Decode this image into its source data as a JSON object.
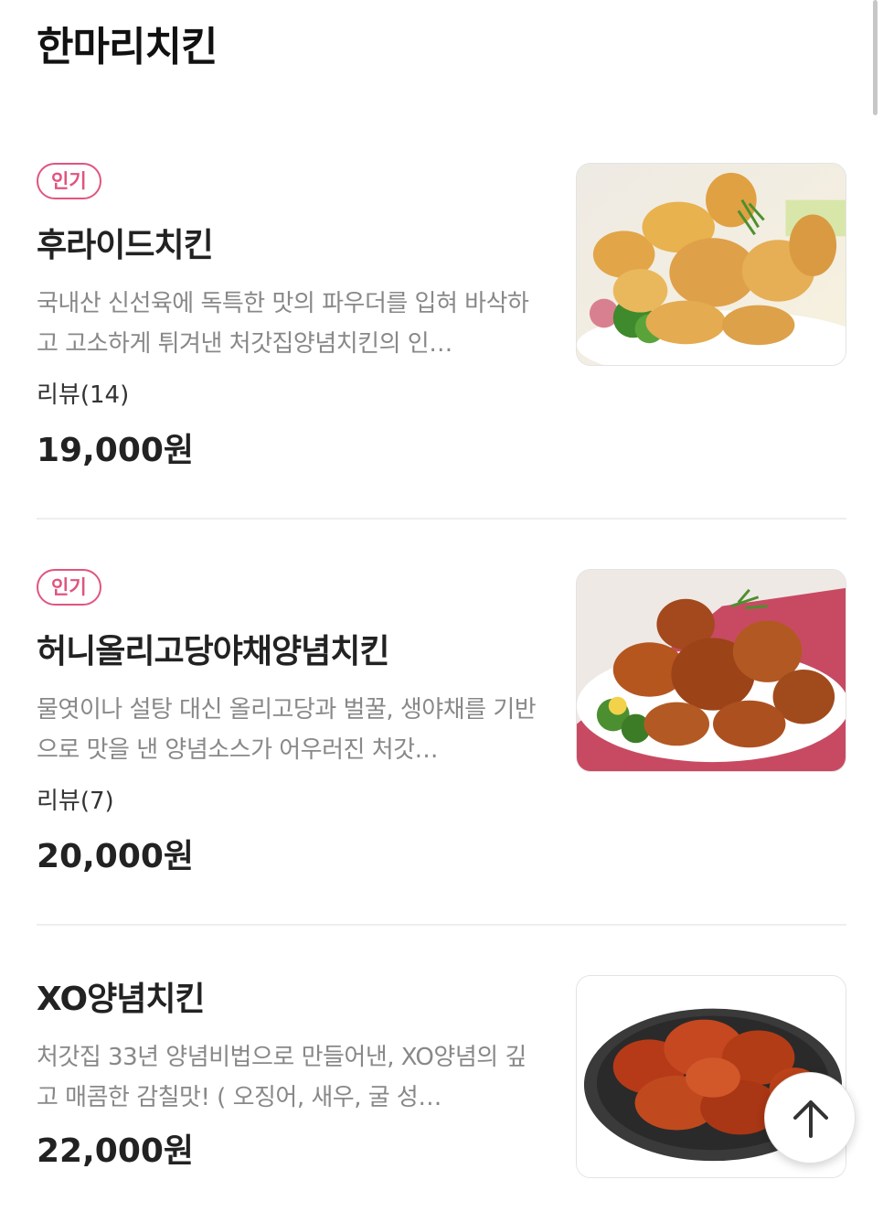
{
  "page": {
    "section_title": "한마리치킨"
  },
  "menu_items": [
    {
      "badge": "인기",
      "name": "후라이드치킨",
      "description": "국내산 신선육에 독특한 맛의 파우더를 입혀 바삭하고 고소하게 튀겨낸 처갓집양념치킨의 인…",
      "review": "리뷰(14)",
      "price": "19,000원",
      "image_icon": "fried-chicken-image"
    },
    {
      "badge": "인기",
      "name": "허니올리고당야채양념치킨",
      "description": "물엿이나 설탕 대신 올리고당과 벌꿀, 생야채를 기반으로 맛을 낸 양념소스가 어우러진 처갓…",
      "review": "리뷰(7)",
      "price": "20,000원",
      "image_icon": "honey-seasoned-chicken-image"
    },
    {
      "badge": "",
      "name": "XO양념치킨",
      "description": "처갓집 33년 양념비법으로 만들어낸, XO양념의 깊고 매콤한 감칠맛! ( 오징어, 새우, 굴 성…",
      "review": "",
      "price": "22,000원",
      "image_icon": "xo-seasoned-chicken-image"
    }
  ],
  "scroll_top_button": {
    "icon": "arrow-up-icon"
  },
  "colors": {
    "accent_badge": "#e0557e",
    "text_primary": "#222222",
    "text_secondary": "#888888",
    "divider": "#eeeeee"
  }
}
